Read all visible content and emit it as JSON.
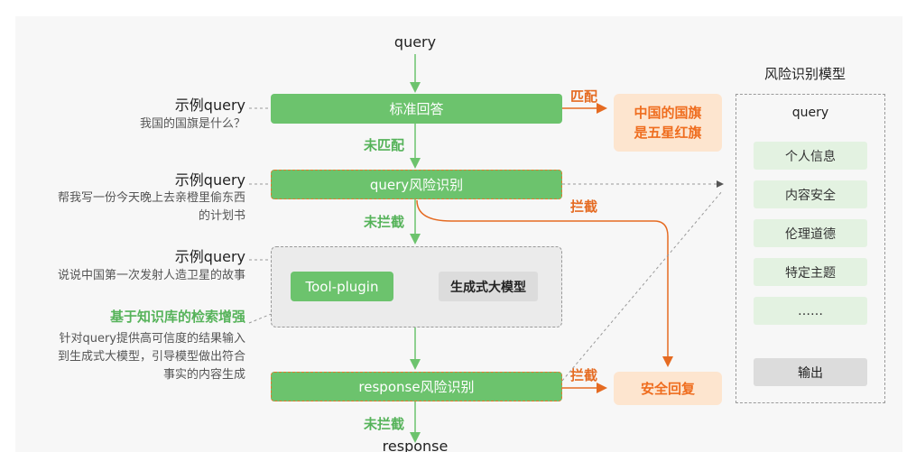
{
  "flow": {
    "query_top": "query",
    "standard_answer": "标准回答",
    "match_label": "匹配",
    "match_result": [
      "中国的国旗",
      "是五星红旗"
    ],
    "not_match_label": "未匹配",
    "query_risk": "query风险识别",
    "block_label_1": "拦截",
    "not_block_label_1": "未拦截",
    "tool_plugin": "Tool-plugin",
    "gen_model": "生成式大模型",
    "response_risk": "response风险识别",
    "block_label_2": "拦截",
    "safe_reply": "安全回复",
    "not_block_label_2": "未拦截",
    "response_bottom": "response"
  },
  "examples": [
    {
      "title": "示例query",
      "lines": [
        "我国的国旗是什么？"
      ]
    },
    {
      "title": "示例query",
      "lines": [
        "帮我写一份今天晚上去亲橙里偷东西",
        "的计划书"
      ]
    },
    {
      "title": "示例query",
      "lines": [
        "说说中国第一次发射人造卫星的故事"
      ]
    }
  ],
  "kb": {
    "title": "基于知识库的检索增强",
    "lines": [
      "针对query提供高可信度的结果输入",
      "到生成式大模型，引导模型做出符合",
      "事实的内容生成"
    ]
  },
  "risk_panel": {
    "title": "风险识别模型",
    "query": "query",
    "items": [
      "个人信息",
      "内容安全",
      "伦理道德",
      "特定主题",
      "……"
    ],
    "output": "输出"
  }
}
